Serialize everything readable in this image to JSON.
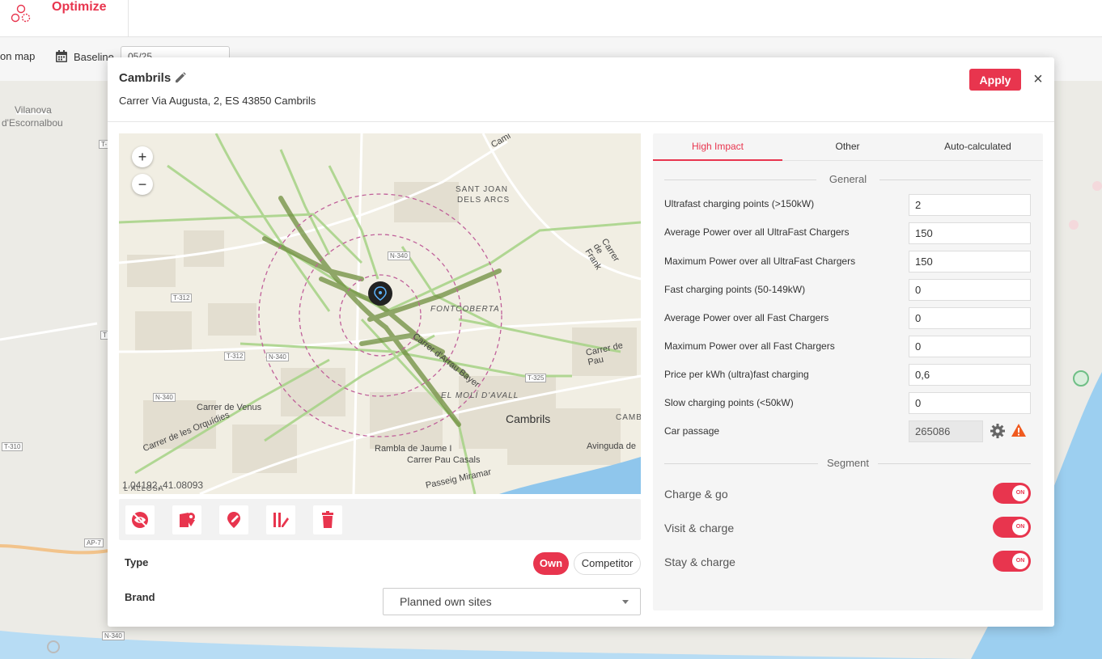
{
  "app": {
    "name": "Optimize"
  },
  "toolbar": {
    "on_map_label": "on map",
    "baseline_label": "Baseline",
    "date_value": "05/25"
  },
  "background_map": {
    "labels": [
      "Vilanova",
      "d'Escornalbou"
    ],
    "shields": [
      "T-",
      "T",
      "T-310",
      "AP-7",
      "N-340"
    ]
  },
  "modal": {
    "title": "Cambrils",
    "address": "Carrer Via Augusta, 2, ES 43850 Cambrils",
    "apply_label": "Apply",
    "close_symbol": "×",
    "map": {
      "zoom_in": "+",
      "zoom_out": "−",
      "coords": "1.04192, 41.08093",
      "labels": [
        "SANT JOAN",
        "DELS ARCS",
        "FONTCOBERTA",
        "EL MOLÍ D'AVALL",
        "Cambrils",
        "Carrer de Venus",
        "Carrer de les Orquídies",
        "Rambla de Jaume I",
        "Carrer Pau Casals",
        "Passeig Miramar",
        "Avinguda de",
        "Carrer de Pau",
        "Carrer de Frank",
        "Carrer d'Arrau Bayer",
        "CAMB",
        "L'ALLOSA",
        "Cami"
      ],
      "shields": [
        "N-340",
        "T-312",
        "T-312",
        "N-340",
        "N-340",
        "T-325"
      ]
    },
    "type": {
      "label": "Type",
      "options": [
        "Own",
        "Competitor"
      ],
      "selected": "Own"
    },
    "brand": {
      "label": "Brand",
      "value": "Planned own sites"
    },
    "tabs": [
      "High Impact",
      "Other",
      "Auto-calculated"
    ],
    "active_tab": "High Impact",
    "general": {
      "title": "General",
      "fields": [
        {
          "label": "Ultrafast charging points (>150kW)",
          "value": "2"
        },
        {
          "label": "Average Power over all UltraFast Chargers",
          "value": "150"
        },
        {
          "label": "Maximum Power over all UltraFast Chargers",
          "value": "150"
        },
        {
          "label": "Fast charging points (50-149kW)",
          "value": "0"
        },
        {
          "label": "Average Power over all Fast Chargers",
          "value": "0"
        },
        {
          "label": "Maximum Power over all Fast Chargers",
          "value": "0"
        },
        {
          "label": "Price per kWh (ultra)fast charging",
          "value": "0,6"
        },
        {
          "label": "Slow charging points (<50kW)",
          "value": "0"
        }
      ],
      "car_passage": {
        "label": "Car passage",
        "value": "265086"
      }
    },
    "segment": {
      "title": "Segment",
      "items": [
        {
          "label": "Charge & go",
          "state": "ON"
        },
        {
          "label": "Visit & charge",
          "state": "ON"
        },
        {
          "label": "Stay & charge",
          "state": "ON"
        }
      ]
    }
  },
  "colors": {
    "accent": "#e8354e",
    "road_green": "#a9d48a",
    "heat_green": "#6f8f3e",
    "ring": "#c0609a",
    "water": "#8fc6ec"
  }
}
